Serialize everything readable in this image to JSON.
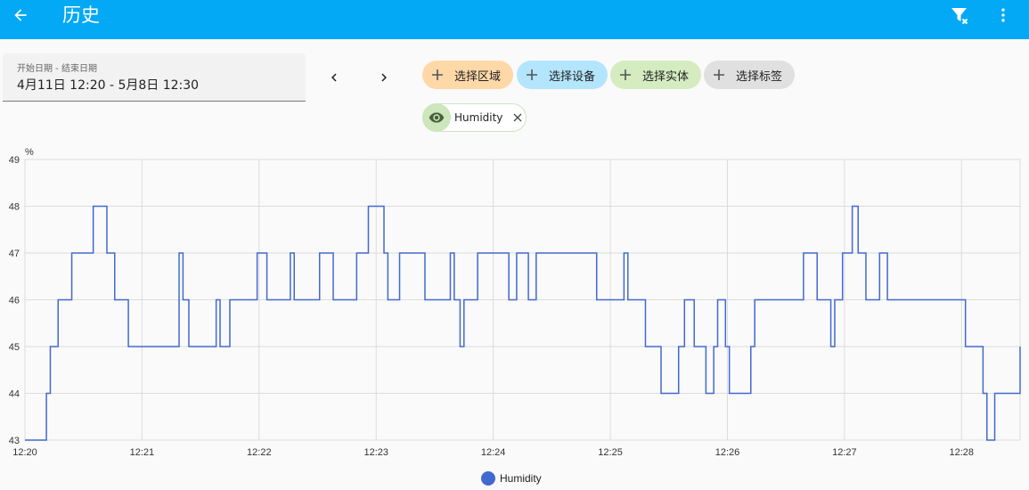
{
  "header": {
    "title": "历史"
  },
  "date_range": {
    "label": "开始日期 - 结束日期",
    "value": "4月11日 12:20 - 5月8日 12:30"
  },
  "target_chips": [
    {
      "label": "选择区域",
      "color": "#ffd8a8"
    },
    {
      "label": "选择设备",
      "color": "#b3e5fc"
    },
    {
      "label": "选择实体",
      "color": "#d4ecc0"
    },
    {
      "label": "选择标签",
      "color": "#e0e0e0"
    }
  ],
  "selected_entity": {
    "name": "Humidity"
  },
  "colors": {
    "appbar": "#03a9f4",
    "line": "#4269d0"
  },
  "chart_data": {
    "type": "line",
    "step": true,
    "unit": "%",
    "ylim": [
      43,
      49
    ],
    "yticks": [
      "43",
      "44",
      "45",
      "46",
      "47",
      "48",
      "49"
    ],
    "xticks": [
      "12:20",
      "12:21",
      "12:22",
      "12:23",
      "12:24",
      "12:25",
      "12:26",
      "12:27",
      "12:28"
    ],
    "grid": true,
    "legend_position": "bottom-center",
    "series": [
      {
        "name": "Humidity",
        "x": [
          "12:20:00",
          "12:20:11",
          "12:20:13",
          "12:20:17",
          "12:20:24",
          "12:20:35",
          "12:20:42",
          "12:20:46",
          "12:20:53",
          "12:21:19",
          "12:21:21",
          "12:21:24",
          "12:21:38",
          "12:21:40",
          "12:21:45",
          "12:21:59",
          "12:22:04",
          "12:22:16",
          "12:22:18",
          "12:22:31",
          "12:22:38",
          "12:22:50",
          "12:22:56",
          "12:23:04",
          "12:23:06",
          "12:23:12",
          "12:23:25",
          "12:23:38",
          "12:23:40",
          "12:23:43",
          "12:23:45",
          "12:23:52",
          "12:24:08",
          "12:24:12",
          "12:24:18",
          "12:24:22",
          "12:24:46",
          "12:24:53",
          "12:25:07",
          "12:25:09",
          "12:25:18",
          "12:25:26",
          "12:25:35",
          "12:25:38",
          "12:25:43",
          "12:25:49",
          "12:25:53",
          "12:25:55",
          "12:25:59",
          "12:26:01",
          "12:26:12",
          "12:26:14",
          "12:26:39",
          "12:26:46",
          "12:26:53",
          "12:26:55",
          "12:26:59",
          "12:27:04",
          "12:27:07",
          "12:27:11",
          "12:27:18",
          "12:27:22",
          "12:28:02",
          "12:28:11",
          "12:28:13",
          "12:28:17",
          "12:28:30"
        ],
        "values": [
          43,
          44,
          45,
          46,
          47,
          48,
          47,
          46,
          45,
          47,
          46,
          45,
          46,
          45,
          46,
          47,
          46,
          47,
          46,
          47,
          46,
          47,
          48,
          47,
          46,
          47,
          46,
          47,
          46,
          45,
          46,
          47,
          46,
          47,
          46,
          47,
          47,
          46,
          47,
          46,
          45,
          44,
          45,
          46,
          45,
          44,
          45,
          46,
          45,
          44,
          45,
          46,
          47,
          46,
          45,
          46,
          47,
          48,
          47,
          46,
          47,
          46,
          45,
          44,
          43,
          44,
          45
        ]
      }
    ]
  }
}
